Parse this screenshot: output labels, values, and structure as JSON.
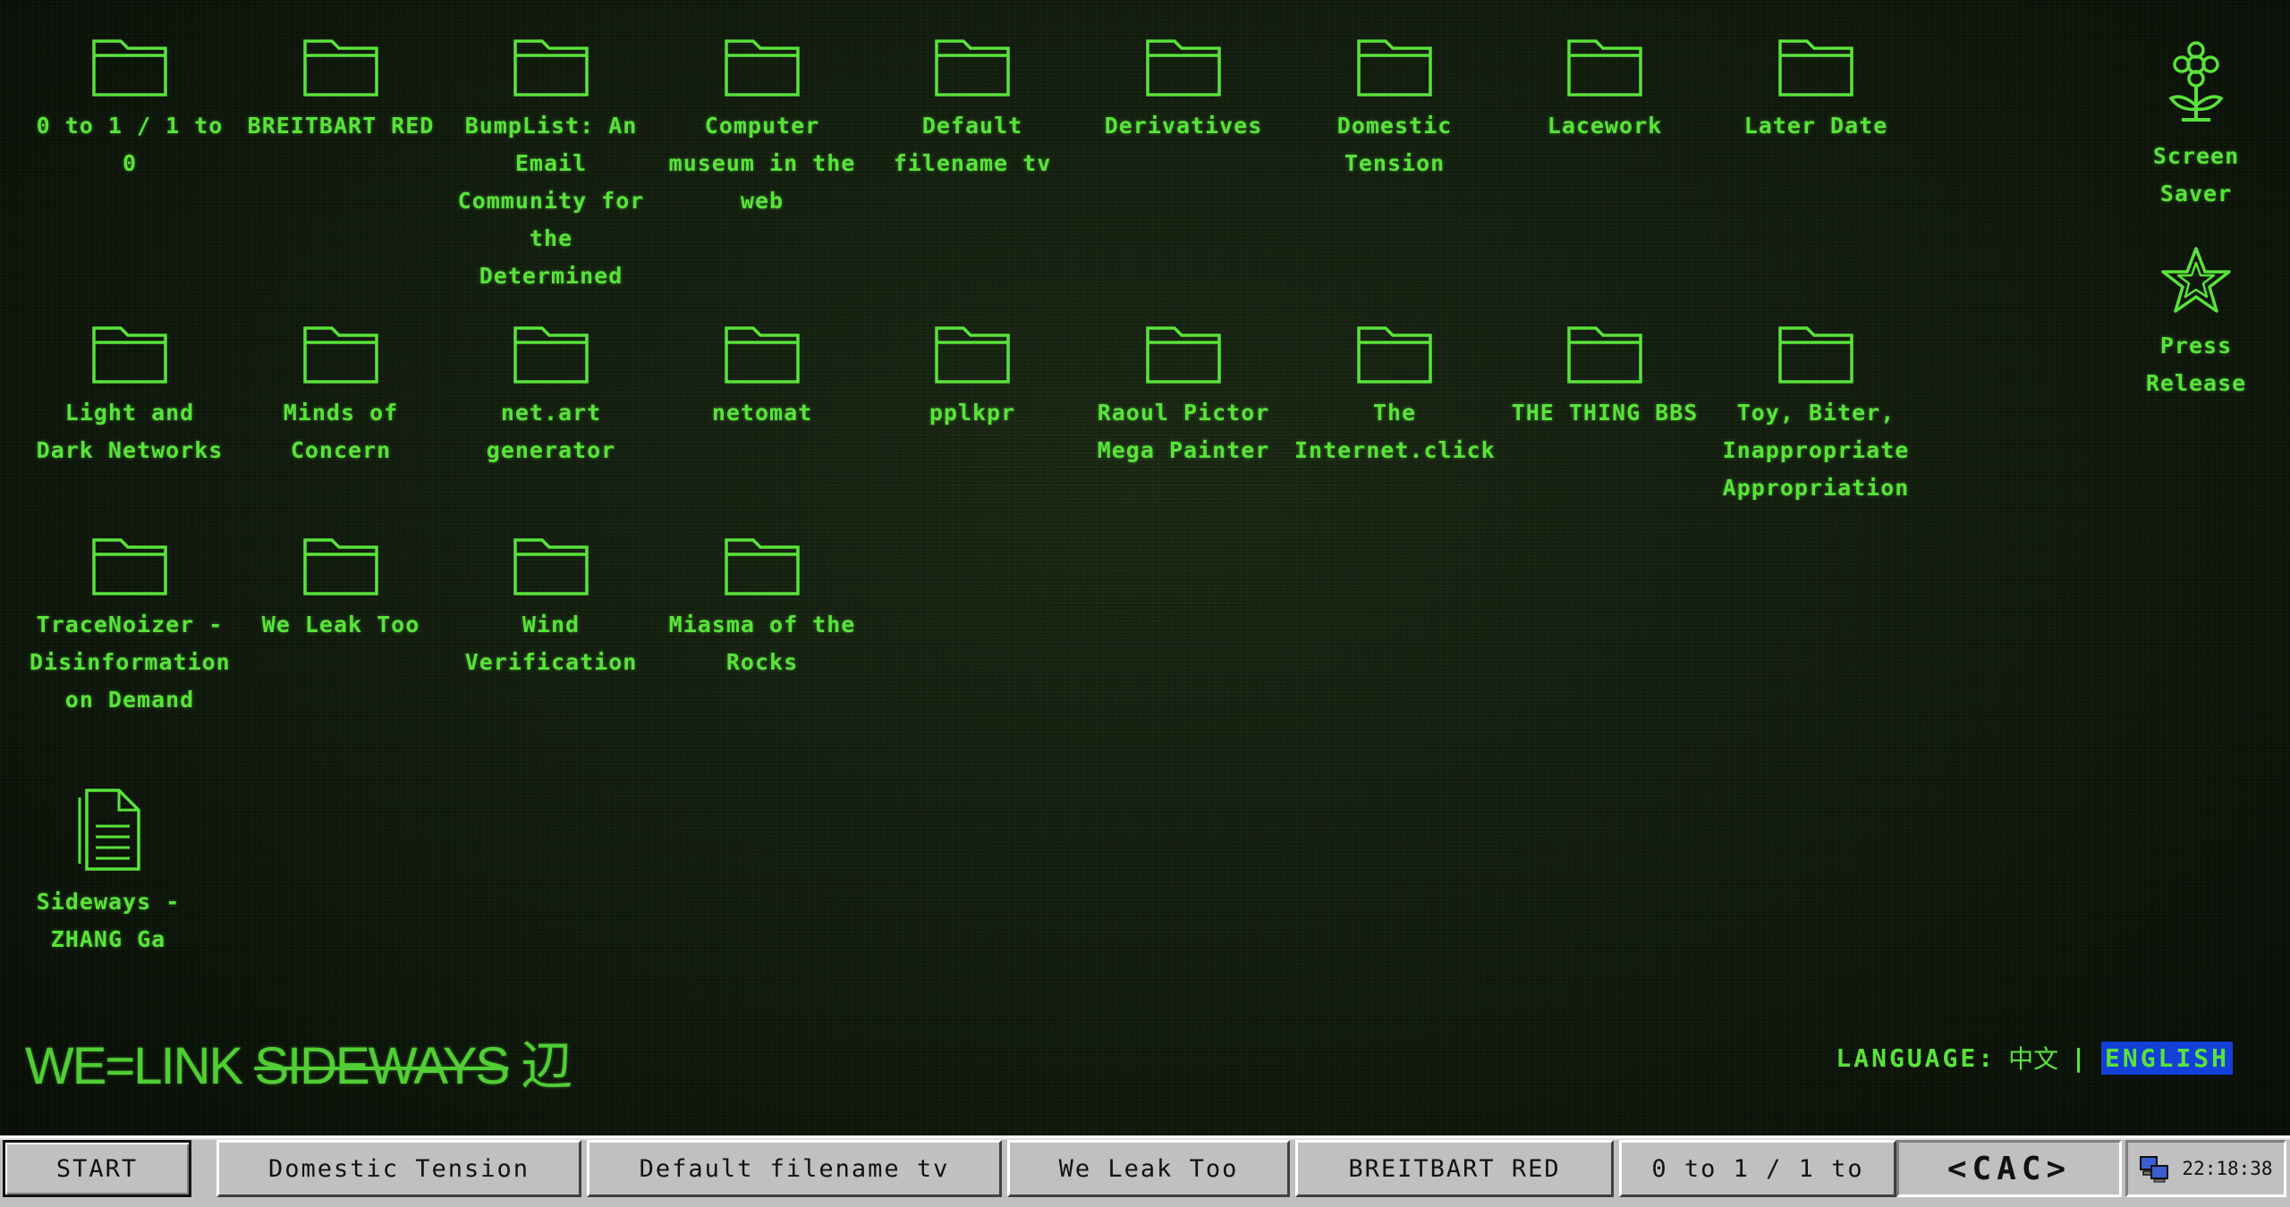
{
  "folders": [
    {
      "label": "0 to 1 / 1 to 0"
    },
    {
      "label": "BREITBART RED"
    },
    {
      "label": "BumpList: An Email Community for the Determined"
    },
    {
      "label": "Computer museum in the web"
    },
    {
      "label": "Default filename tv"
    },
    {
      "label": "Derivatives"
    },
    {
      "label": "Domestic Tension"
    },
    {
      "label": "Lacework"
    },
    {
      "label": "Later Date"
    },
    {
      "label": "Light and Dark Networks"
    },
    {
      "label": "Minds of Concern"
    },
    {
      "label": "net.art generator"
    },
    {
      "label": "netomat"
    },
    {
      "label": "pplkpr"
    },
    {
      "label": "Raoul Pictor Mega Painter"
    },
    {
      "label": "The Internet.click"
    },
    {
      "label": "THE THING BBS"
    },
    {
      "label": "Toy, Biter, Inappropriate Appropriation"
    },
    {
      "label": "TraceNoizer - Disinformation on Demand"
    },
    {
      "label": "We Leak Too"
    },
    {
      "label": "Wind Verification"
    },
    {
      "label": "Miasma of the Rocks"
    }
  ],
  "document": {
    "label": "Sideways - ZHANG Ga",
    "icon": "document-icon"
  },
  "side_icons": [
    {
      "label": "Screen Saver",
      "icon": "flower-icon"
    },
    {
      "label": "Press Release",
      "icon": "star-icon"
    }
  ],
  "brand": {
    "prefix": "WE=LINK ",
    "strike": "SIDEWAYS",
    "suffix": " 辺"
  },
  "language": {
    "label": "LANGUAGE:",
    "zh": "中文",
    "separator": "|",
    "en": "ENGLISH",
    "active": "en"
  },
  "taskbar": {
    "start": "START",
    "tasks": [
      "Domestic Tension",
      "Default filename tv",
      "We Leak Too",
      "BREITBART RED",
      "0 to 1 / 1 to"
    ],
    "cac": "<CAC>",
    "clock": "22:18:38"
  },
  "colors": {
    "accent": "#59e33a",
    "taskbar": "#c0c0c0",
    "selected_language_bg": "#1340d8"
  }
}
